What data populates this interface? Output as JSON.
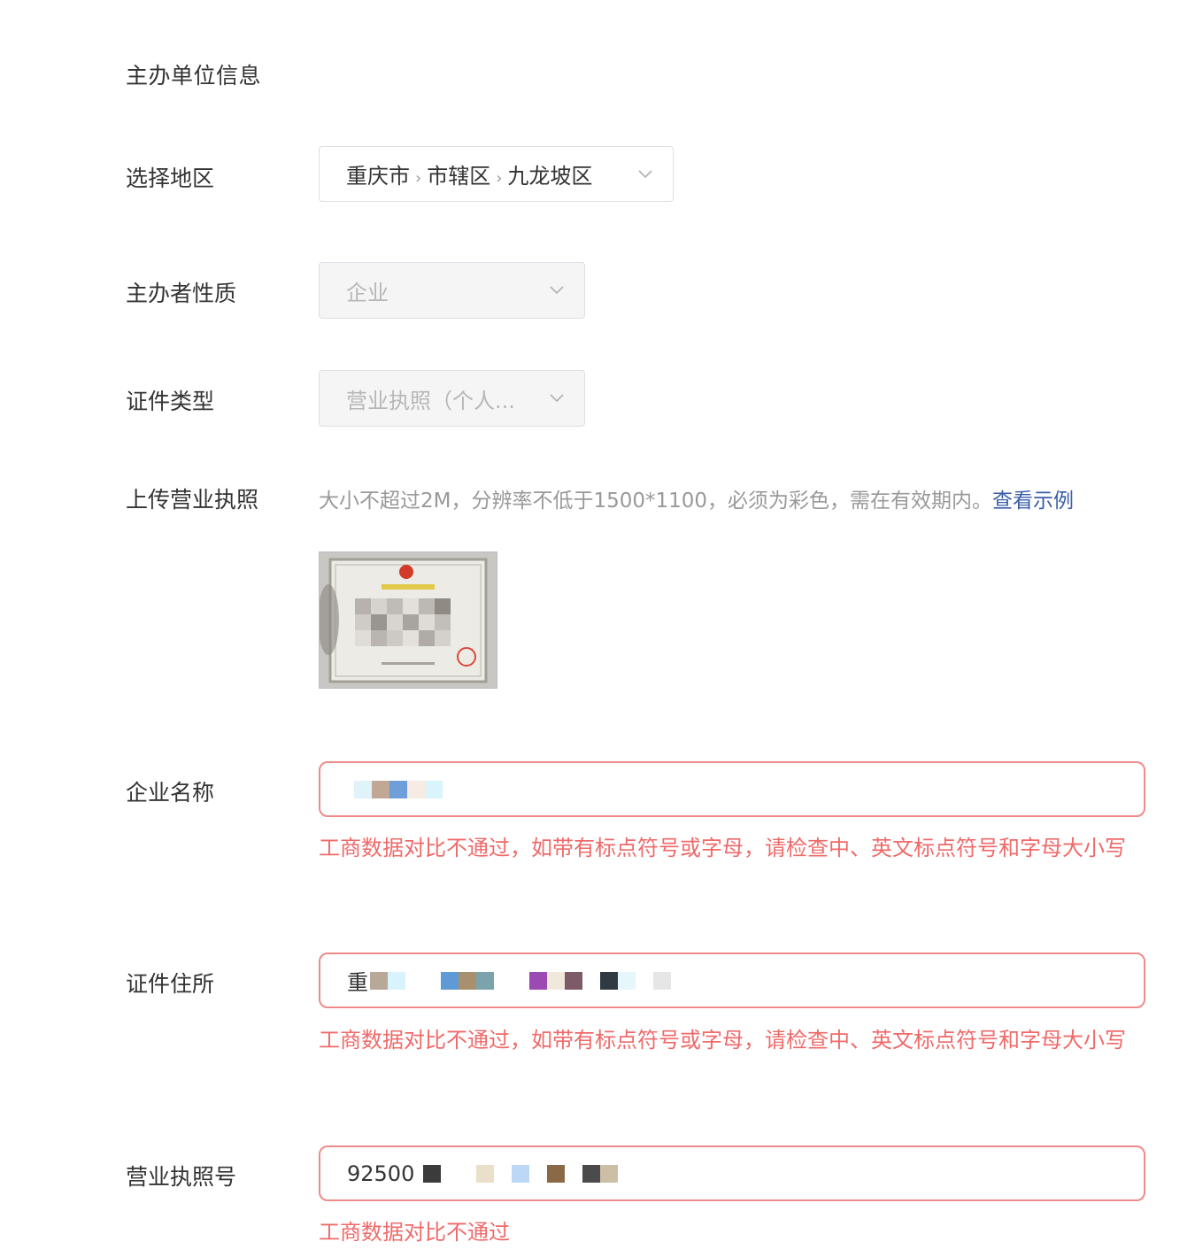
{
  "section": {
    "title": "主办单位信息"
  },
  "region": {
    "label": "选择地区",
    "path": [
      "重庆市",
      "市辖区",
      "九龙坡区"
    ]
  },
  "organizer_type": {
    "label": "主办者性质",
    "value": "企业"
  },
  "cert_type": {
    "label": "证件类型",
    "value": "营业执照（个人..."
  },
  "upload": {
    "label": "上传营业执照",
    "hint": "大小不超过2M，分辨率不低于1500*1100，必须为彩色，需在有效期内。",
    "example_link": "查看示例"
  },
  "company_name": {
    "label": "企业名称",
    "value": "",
    "error": "工商数据对比不通过，如带有标点符号或字母，请检查中、英文标点符号和字母大小写"
  },
  "cert_address": {
    "label": "证件住所",
    "value": "重",
    "error": "工商数据对比不通过，如带有标点符号或字母，请检查中、英文标点符号和字母大小写"
  },
  "license_no": {
    "label": "营业执照号",
    "value": "92500",
    "error": "工商数据对比不通过"
  },
  "colors": {
    "error_text": "#ef6a6a",
    "error_border": "#f08a8a",
    "link": "#3a5ea8"
  }
}
